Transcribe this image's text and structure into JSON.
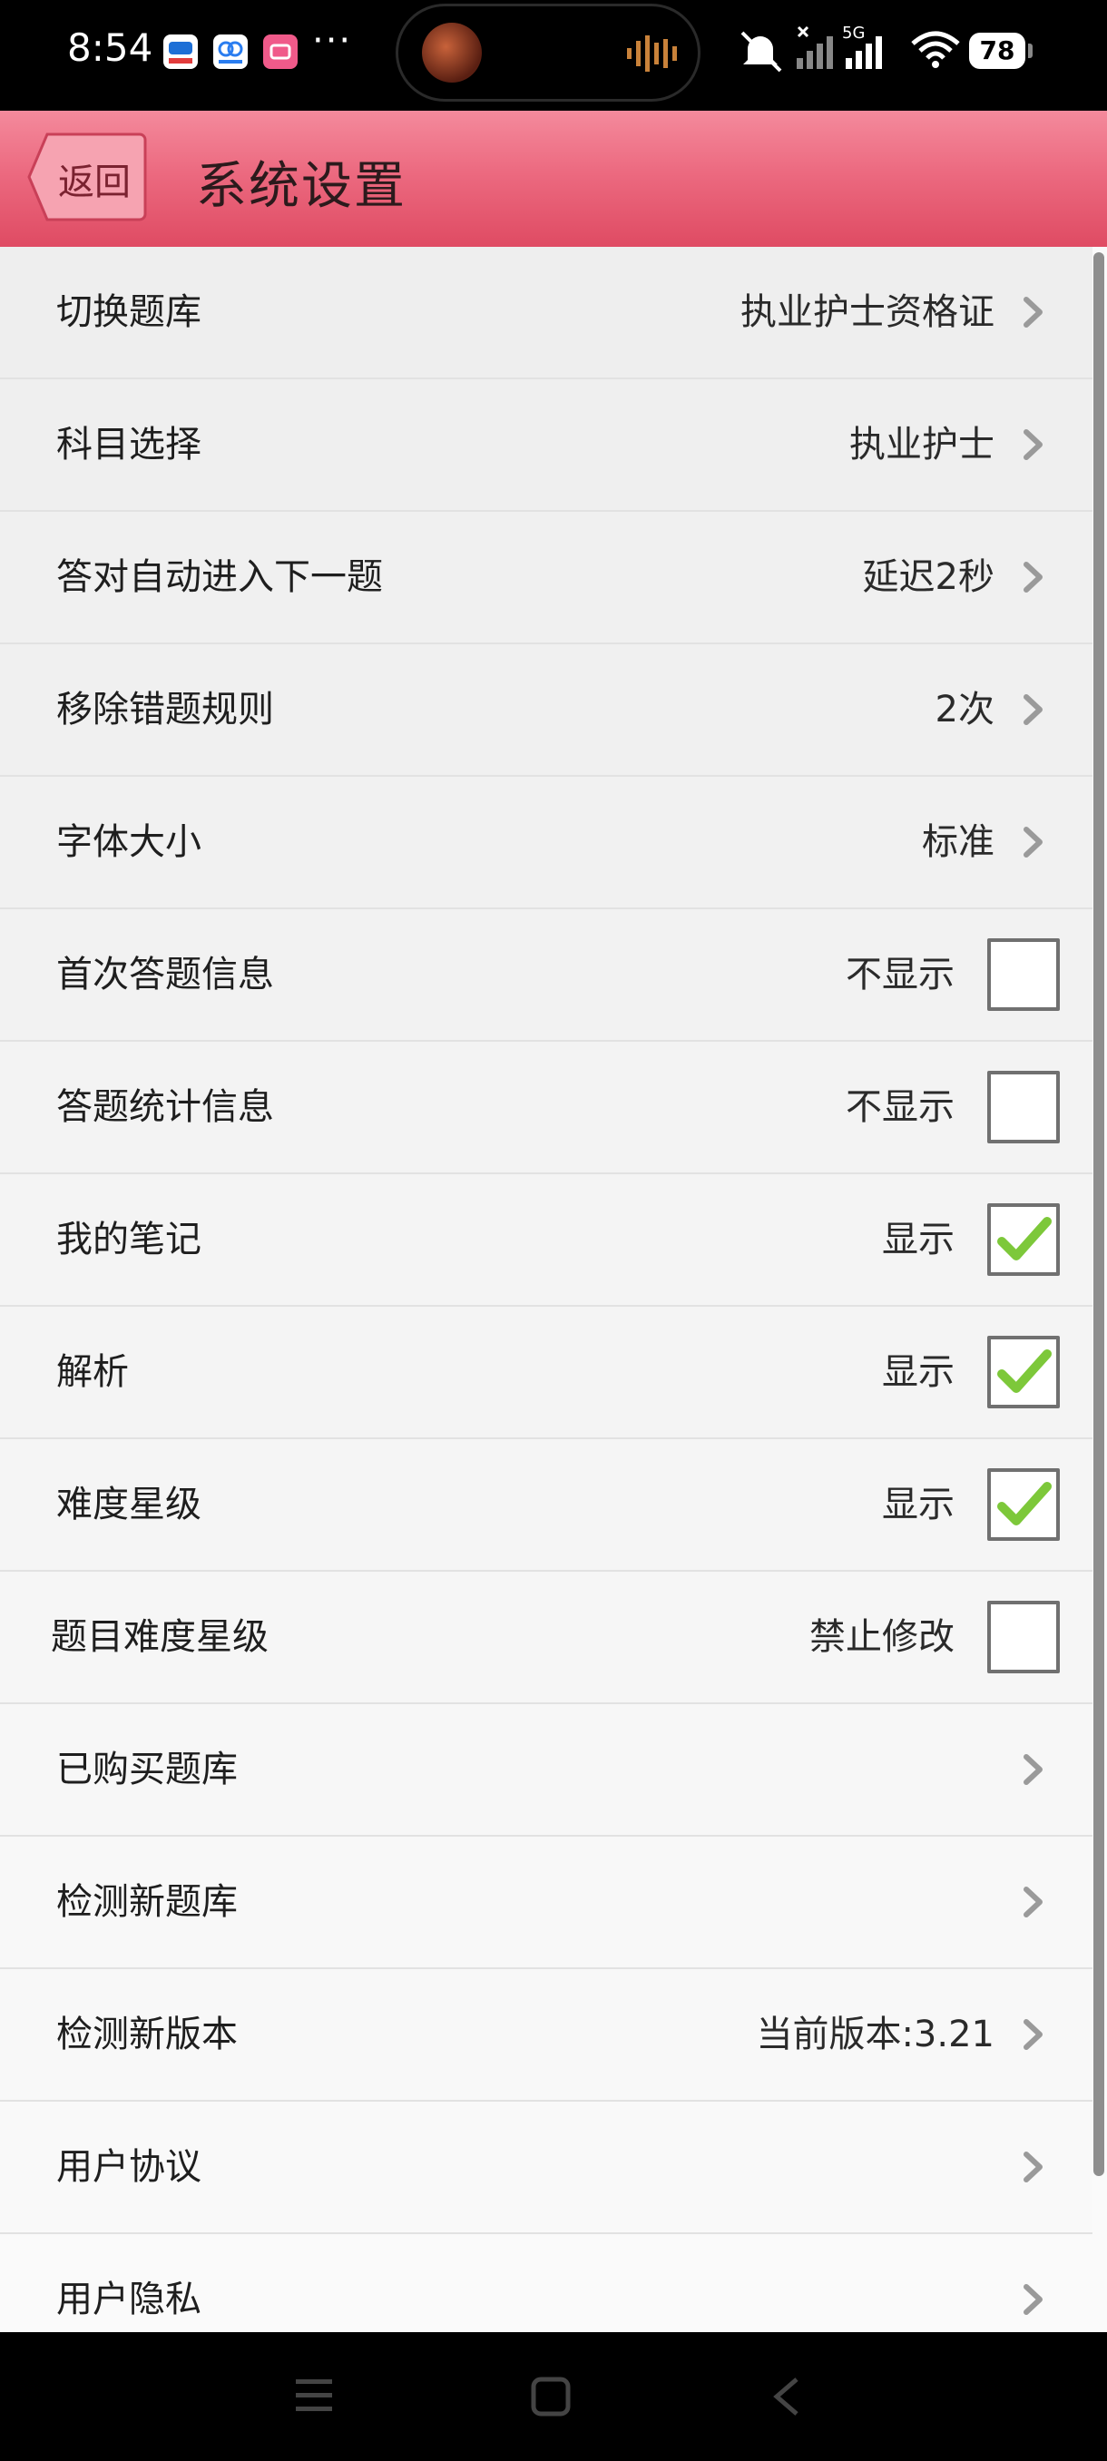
{
  "status_bar": {
    "time": "8:54",
    "more": "···",
    "network": "5G",
    "battery": "78",
    "icons": [
      "app-icon-1",
      "app-icon-2",
      "app-icon-3",
      "mute-icon",
      "no-signal-icon",
      "signal-icon",
      "wifi-icon",
      "battery-icon"
    ]
  },
  "header": {
    "back_label": "返回",
    "title": "系统设置"
  },
  "settings": [
    {
      "label": "切换题库",
      "value": "执业护士资格证",
      "type": "link"
    },
    {
      "label": "科目选择",
      "value": "执业护士",
      "type": "link"
    },
    {
      "label": "答对自动进入下一题",
      "value": "延迟2秒",
      "type": "link"
    },
    {
      "label": "移除错题规则",
      "value": "2次",
      "type": "link"
    },
    {
      "label": "字体大小",
      "value": "标准",
      "type": "link"
    },
    {
      "label": "首次答题信息",
      "value": "不显示",
      "type": "checkbox",
      "checked": false
    },
    {
      "label": "答题统计信息",
      "value": "不显示",
      "type": "checkbox",
      "checked": false
    },
    {
      "label": "我的笔记",
      "value": "显示",
      "type": "checkbox",
      "checked": true
    },
    {
      "label": "解析",
      "value": "显示",
      "type": "checkbox",
      "checked": true
    },
    {
      "label": "难度星级",
      "value": "显示",
      "type": "checkbox",
      "checked": true
    },
    {
      "label": "题目难度星级",
      "value": "禁止修改",
      "type": "checkbox",
      "checked": false
    },
    {
      "label": "已购买题库",
      "value": "",
      "type": "link"
    },
    {
      "label": "检测新题库",
      "value": "",
      "type": "link"
    },
    {
      "label": "检测新版本",
      "value": "当前版本:3.21",
      "type": "link"
    },
    {
      "label": "用户协议",
      "value": "",
      "type": "link"
    },
    {
      "label": "用户隐私",
      "value": "",
      "type": "link"
    }
  ],
  "colors": {
    "header_top": "#f48a9c",
    "header_bottom": "#df4b63",
    "check_green": "#7dc83a"
  }
}
